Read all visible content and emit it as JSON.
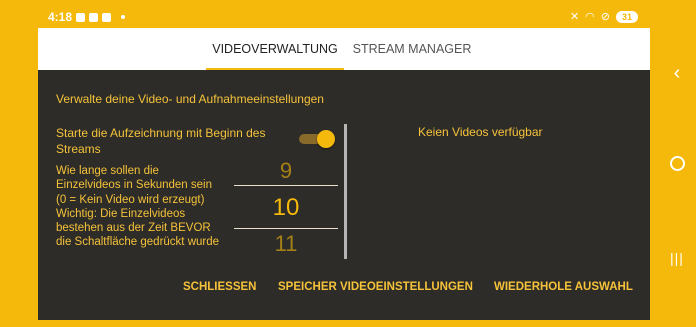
{
  "status_bar": {
    "time": "4:18",
    "battery": "31"
  },
  "tabs": [
    {
      "label": "VIDEOVERWALTUNG",
      "active": true
    },
    {
      "label": "STREAM MANAGER",
      "active": false
    }
  ],
  "settings": {
    "intro": "Verwalte deine Video- und Aufnahmeeinstellungen",
    "record_label": "Starte die Aufzeichnung mit Beginn des Streams",
    "record_toggle_on": true,
    "duration_label_lines": [
      "Wie lange sollen die",
      "Einzelvideos in Sekunden sein",
      "(0 = Kein Video wird erzeugt)",
      "Wichtig: Die Einzelvideos",
      "bestehen aus der Zeit BEVOR",
      "die Schaltfläche gedrückt wurde"
    ],
    "picker": {
      "previous": "9",
      "selected": "10",
      "next": "11"
    },
    "no_videos": "Keien Videos verfügbar"
  },
  "actions": {
    "close": "SCHLIESSEN",
    "save": "SPEICHER VIDEOEINSTELLUNGEN",
    "repeat": "WIEDERHOLE AUSWAHL"
  },
  "nav": {
    "back_glyph": "‹",
    "recent_glyph": "|||"
  },
  "colors": {
    "accent": "#f5b90c",
    "panel": "#2d2c28",
    "text": "#f5c23a"
  }
}
